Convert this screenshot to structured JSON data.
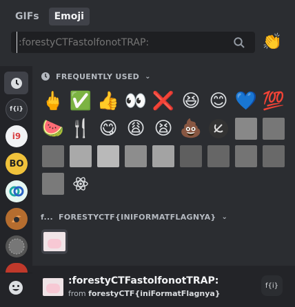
{
  "tabs": [
    {
      "label": "GIFs",
      "active": false
    },
    {
      "label": "Emoji",
      "active": true
    }
  ],
  "search": {
    "placeholder": ":forestyCTFastolfonotTRAP:"
  },
  "categories": {
    "frequent": "FREQUENTLY USED",
    "server": "FORESTYCTF{INIFORMATFLAGNYA}",
    "server_short": "f..."
  },
  "frequent_emojis": [
    {
      "char": "🖕",
      "name": "middle-finger-emoji"
    },
    {
      "char": "✅",
      "name": "check-mark-emoji"
    },
    {
      "char": "👍",
      "name": "thumbs-up-emoji"
    },
    {
      "char": "👀",
      "name": "eyes-emoji"
    },
    {
      "char": "❌",
      "name": "cross-mark-emoji"
    },
    {
      "char": "😆",
      "name": "laughing-emoji"
    },
    {
      "char": "😊",
      "name": "smiling-emoji"
    },
    {
      "char": "💙",
      "name": "blue-heart-emoji"
    },
    {
      "char": "💯",
      "name": "hundred-emoji"
    },
    {
      "char": "🍉",
      "name": "watermelon-emoji"
    },
    {
      "char": "🍴",
      "name": "fork-knife-emoji"
    },
    {
      "char": "😋",
      "name": "yum-emoji"
    },
    {
      "char": "😩",
      "name": "weary-emoji"
    },
    {
      "char": "😫",
      "name": "tired-emoji"
    },
    {
      "char": "💩",
      "name": "poop-emoji"
    },
    {
      "char": "☭",
      "name": "hammer-sickle-emoji"
    }
  ],
  "colors": {
    "background": "#2b2d31",
    "rail": "#232428",
    "search_bg": "#1e1f22",
    "selected": "#404249",
    "text": "#dbdee1",
    "muted": "#b5bac1"
  },
  "footer": {
    "name": ":forestyCTFastolfonotTRAP:",
    "from_label": "from",
    "from_server": "forestyCTF{iniFormatFlagnya}",
    "server_chip": "f{i}"
  },
  "rail_icons": {
    "clock": "🕘",
    "server_first": "f{i}",
    "item19": "i9",
    "bo": "BO",
    "smile": "☺"
  }
}
